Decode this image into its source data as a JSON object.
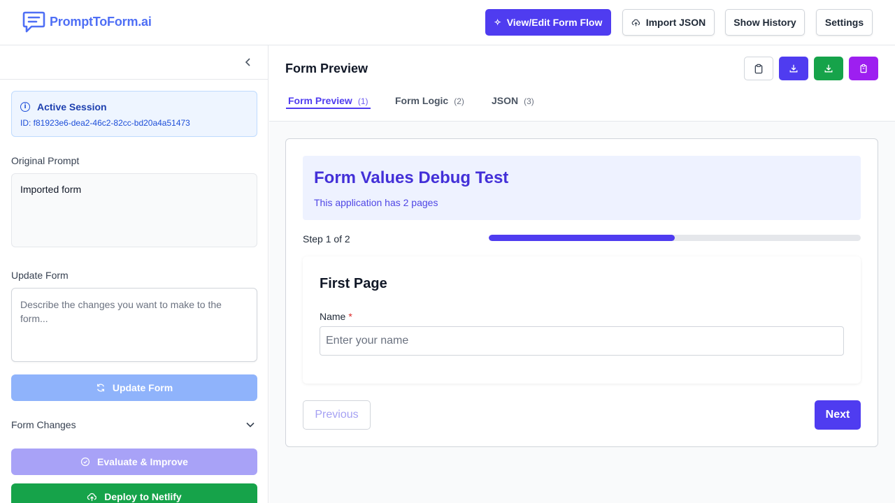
{
  "app": {
    "name": "PromptToForm.ai",
    "brand_color": "#4f6ff5",
    "accent_color": "#4f3cf0"
  },
  "header": {
    "view_edit_label": "View/Edit Form Flow",
    "import_json_label": "Import JSON",
    "show_history_label": "Show History",
    "settings_label": "Settings"
  },
  "sidebar": {
    "session": {
      "title": "Active Session",
      "id": "ID: f81923e6-dea2-46c2-82cc-bd20a4a51473"
    },
    "original_prompt_label": "Original Prompt",
    "original_prompt_value": "Imported form",
    "update_form_label": "Update Form",
    "update_form_placeholder": "Describe the changes you want to make to the form...",
    "update_button_label": "Update Form",
    "form_changes_label": "Form Changes",
    "evaluate_label": "Evaluate & Improve",
    "deploy_label": "Deploy to Netlify"
  },
  "main": {
    "title": "Form Preview",
    "tabs": [
      {
        "label": "Form Preview",
        "count": "(1)"
      },
      {
        "label": "Form Logic",
        "count": "(2)"
      },
      {
        "label": "JSON",
        "count": "(3)"
      }
    ],
    "action_icons": [
      "clipboard-icon",
      "download-icon",
      "download-icon",
      "clipboard-icon"
    ]
  },
  "form": {
    "title": "Form Values Debug Test",
    "subtitle": "This application has 2 pages",
    "step_text": "Step 1 of 2",
    "progress_fraction": 0.5,
    "page_title": "First Page",
    "field_label": "Name",
    "field_required_mark": "*",
    "field_placeholder": "Enter your name",
    "previous_label": "Previous",
    "next_label": "Next"
  }
}
